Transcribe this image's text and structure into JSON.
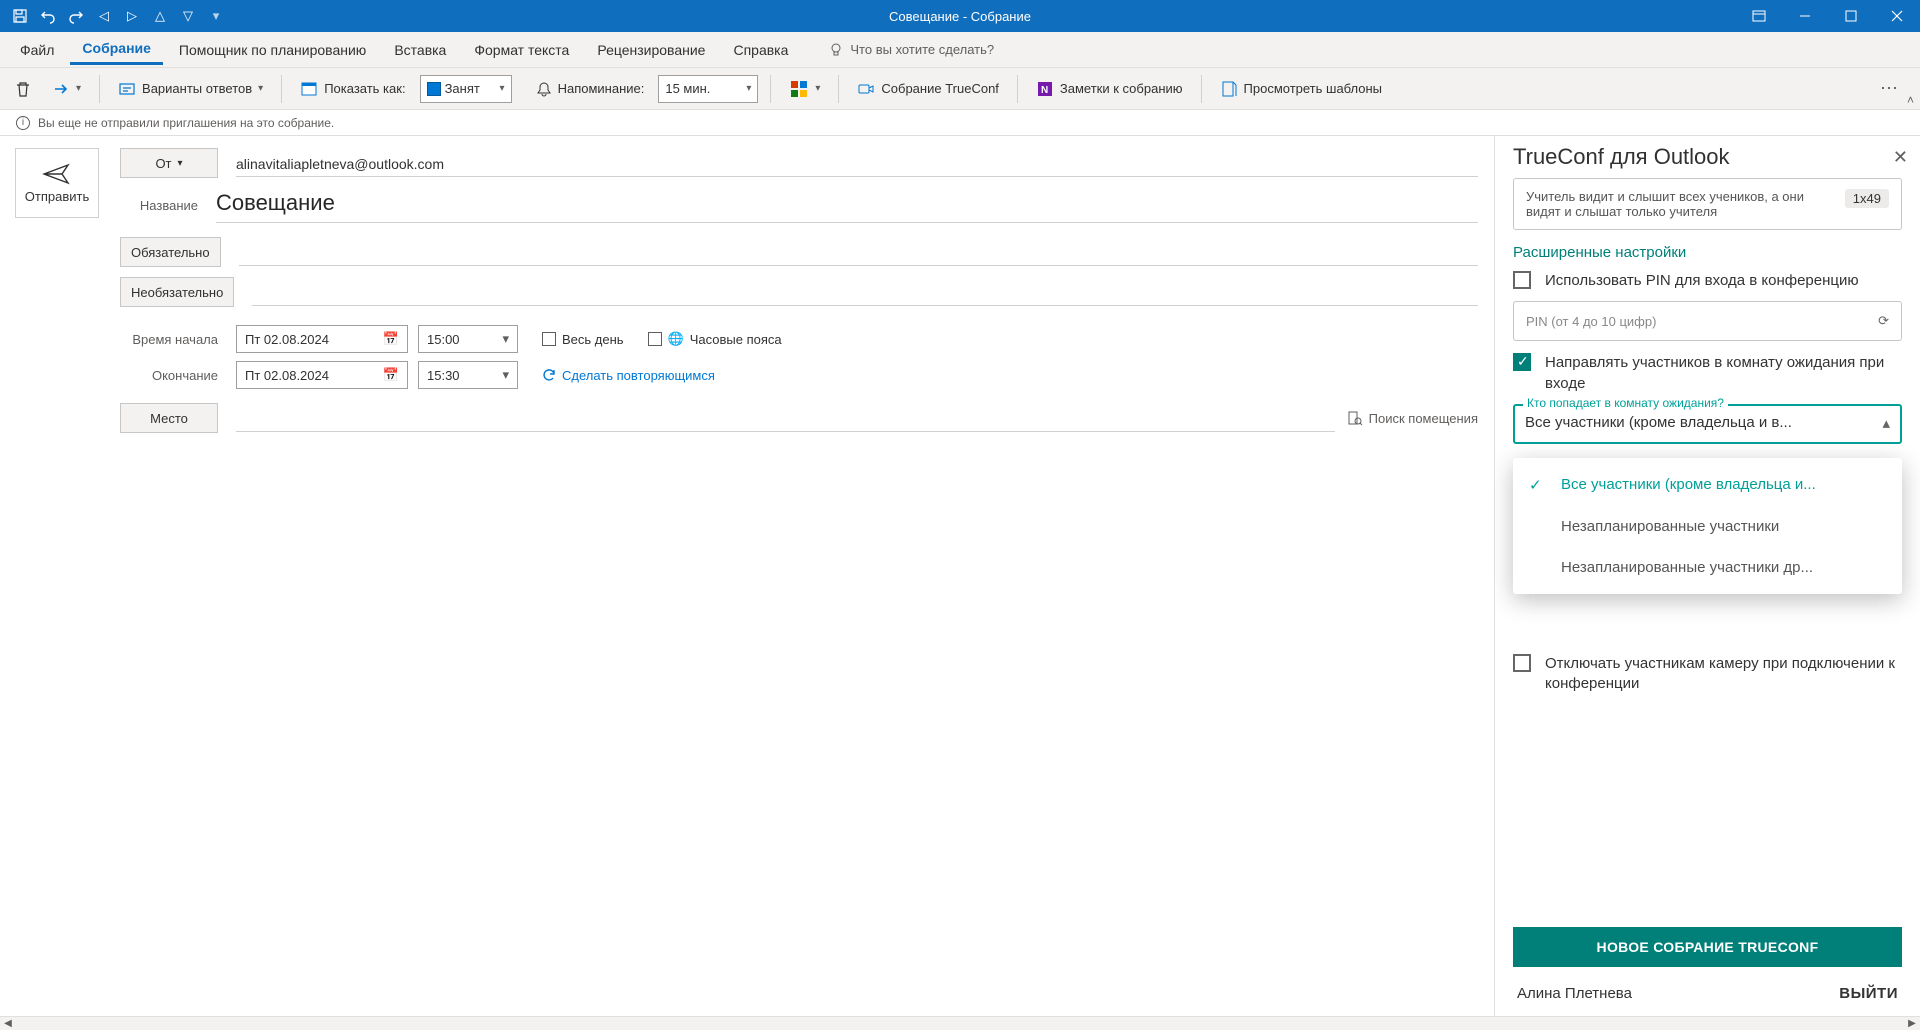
{
  "titlebar": {
    "title": "Совещание  -  Собрание"
  },
  "menu": {
    "tabs": [
      "Файл",
      "Собрание",
      "Помощник по планированию",
      "Вставка",
      "Формат текста",
      "Рецензирование",
      "Справка"
    ],
    "active_index": 1,
    "tell_me": "Что вы хотите сделать?"
  },
  "ribbon": {
    "reply_variants": "Варианты ответов",
    "show_as_label": "Показать как:",
    "show_as_value": "Занят",
    "reminder_label": "Напоминание:",
    "reminder_value": "15 мин.",
    "trueconf_meeting": "Собрание TrueConf",
    "meeting_notes": "Заметки к собранию",
    "view_templates": "Просмотреть шаблоны"
  },
  "infobar": {
    "text": "Вы еще не отправили приглашения на это собрание."
  },
  "form": {
    "send": "Отправить",
    "from_label": "От",
    "from_value": "alinavitaliapletneva@outlook.com",
    "title_label": "Название",
    "title_value": "Совещание",
    "required": "Обязательно",
    "optional": "Необязательно",
    "start_label": "Время начала",
    "end_label": "Окончание",
    "start_date": "Пт 02.08.2024",
    "start_time": "15:00",
    "end_date": "Пт 02.08.2024",
    "end_time": "15:30",
    "all_day": "Весь день",
    "timezones": "Часовые пояса",
    "recurring": "Сделать повторяющимся",
    "location_btn": "Место",
    "room_finder": "Поиск помещения"
  },
  "panel": {
    "title": "TrueConf для Outlook",
    "mode_desc": "Учитель видит и слышит всех учеников, а они видят и слышат только учителя",
    "mode_badge": "1x49",
    "adv_title": "Расширенные настройки",
    "use_pin": "Использовать PIN для входа в конференцию",
    "pin_placeholder": "PIN (от 4 до 10 цифр)",
    "waiting_room": "Направлять участников в комнату ожидания при входе",
    "who_label": "Кто попадает в комнату ожидания?",
    "who_value": "Все участники (кроме владельца и в...",
    "options": [
      "Все участники (кроме владельца и...",
      "Незапланированные участники",
      "Незапланированные участники др..."
    ],
    "mute_camera": "Отключать участникам камеру при подключении к конференции",
    "new_meeting": "НОВОЕ СОБРАНИЕ TRUECONF",
    "user": "Алина Плетнева",
    "logout": "ВЫЙТИ"
  }
}
